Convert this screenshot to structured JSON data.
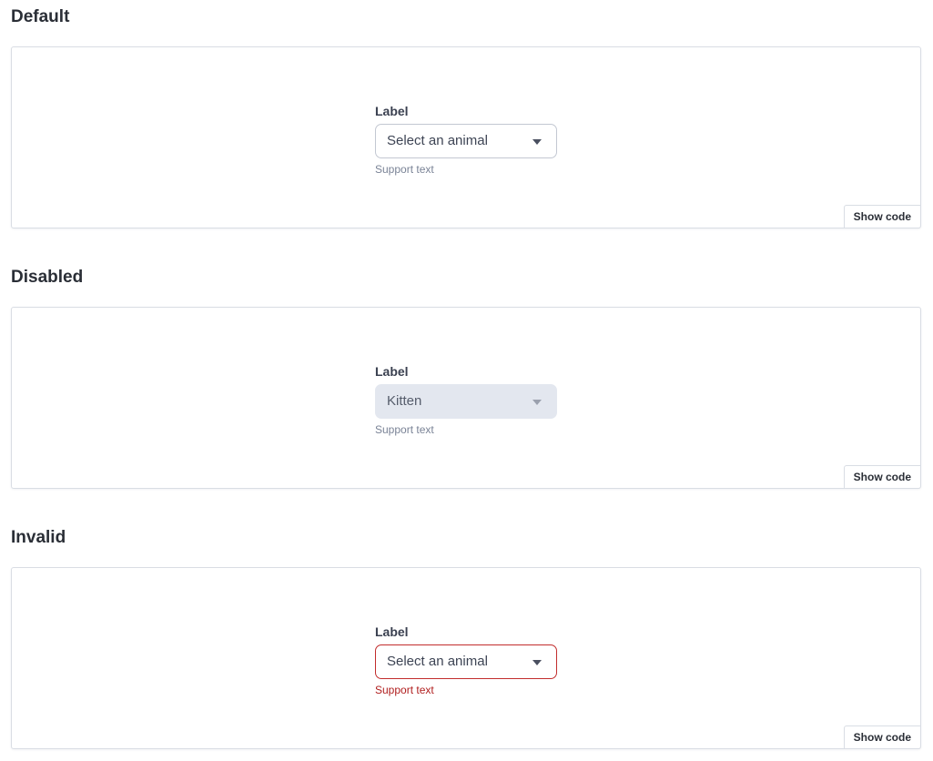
{
  "sections": [
    {
      "title": "Default",
      "field": {
        "label": "Label",
        "value": "Select an animal",
        "support_text": "Support text"
      },
      "show_code_label": "Show code"
    },
    {
      "title": "Disabled",
      "field": {
        "label": "Label",
        "value": "Kitten",
        "support_text": "Support text"
      },
      "show_code_label": "Show code"
    },
    {
      "title": "Invalid",
      "field": {
        "label": "Label",
        "value": "Select an animal",
        "support_text": "Support text"
      },
      "show_code_label": "Show code"
    }
  ],
  "colors": {
    "invalid_border": "#c22d2d",
    "invalid_text": "#b01e1e",
    "disabled_bg": "#e3e7ef",
    "support_text": "#7a8396"
  },
  "icons": {
    "select_caret": "chevron-down-icon"
  }
}
